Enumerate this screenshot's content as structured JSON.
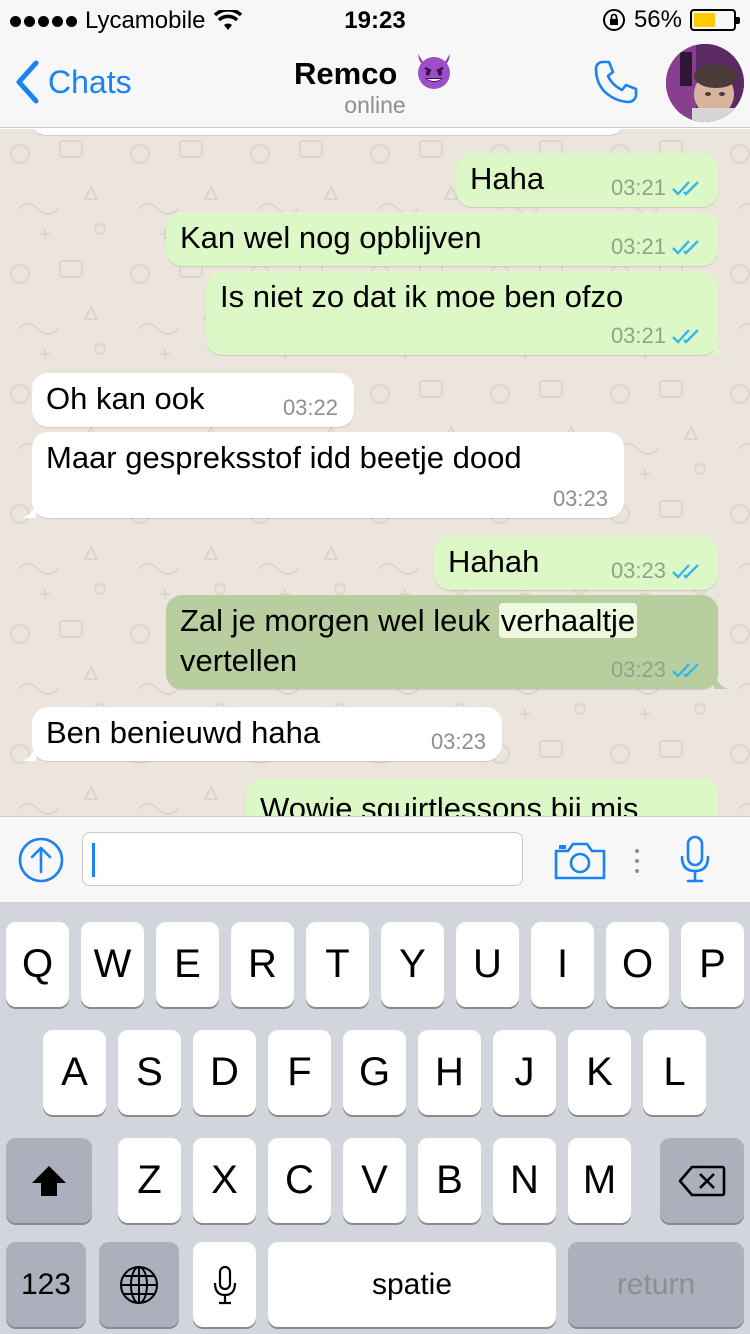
{
  "status_bar": {
    "carrier": "Lycamobile",
    "time": "19:23",
    "battery": "56%",
    "battery_level": 0.56
  },
  "header": {
    "back_label": "Chats",
    "contact_name": "Remco",
    "contact_status": "online"
  },
  "colors": {
    "accent": "#1a82f7",
    "outgoing_bubble": "#dcf8c6",
    "incoming_bubble": "#ffffff",
    "chat_background": "#ece5dd",
    "read_ticks": "#34b7f1"
  },
  "messages": [
    {
      "direction": "out",
      "text": "Haha",
      "time": "03:21",
      "ticks": "read"
    },
    {
      "direction": "out",
      "text": "Kan wel nog opblijven",
      "time": "03:21",
      "ticks": "read"
    },
    {
      "direction": "out",
      "text": "Is niet zo dat ik moe ben ofzo",
      "time": "03:21",
      "ticks": "read"
    },
    {
      "direction": "in",
      "text": "Oh kan ook",
      "time": "03:22"
    },
    {
      "direction": "in",
      "text": "Maar gespreksstof idd beetje dood",
      "time": "03:23"
    },
    {
      "direction": "out",
      "text": "Hahah",
      "time": "03:23",
      "ticks": "read"
    },
    {
      "direction": "out",
      "text_before": "Zal je morgen wel leuk ",
      "text_highlight": "verhaaltje",
      "text_after": "vertellen",
      "time": "03:23",
      "ticks": "read",
      "selected": true
    },
    {
      "direction": "in",
      "text": "Ben benieuwd haha",
      "time": "03:23"
    },
    {
      "direction": "out",
      "text": "Wowie squirtlessons bij mis"
    }
  ],
  "composer": {
    "value": "",
    "icons": [
      "upload-icon",
      "camera-icon",
      "microphone-icon"
    ]
  },
  "keyboard": {
    "row1": [
      "Q",
      "W",
      "E",
      "R",
      "T",
      "Y",
      "U",
      "I",
      "O",
      "P"
    ],
    "row2": [
      "A",
      "S",
      "D",
      "F",
      "G",
      "H",
      "J",
      "K",
      "L"
    ],
    "row3": [
      "Z",
      "X",
      "C",
      "V",
      "B",
      "N",
      "M"
    ],
    "numbers_label": "123",
    "space_label": "spatie",
    "return_label": "return"
  }
}
